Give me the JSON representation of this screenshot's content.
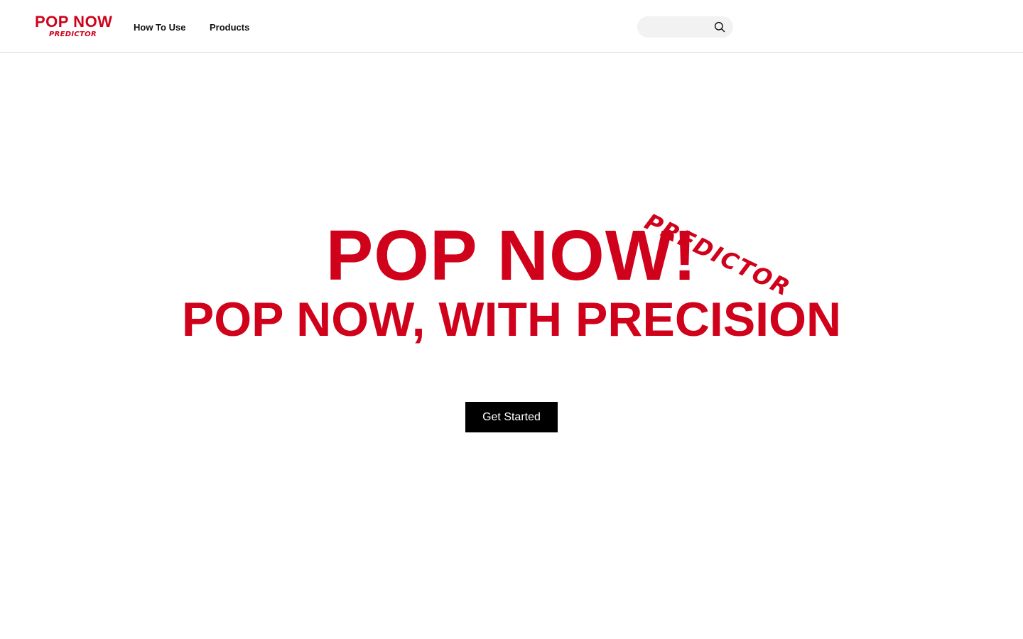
{
  "header": {
    "logo": {
      "main": "POP NOW",
      "sub": "PREDICTOR"
    },
    "nav": {
      "how_to_use": "How To Use",
      "products": "Products"
    },
    "search": {
      "value": "",
      "placeholder": "",
      "icon": "search-icon"
    }
  },
  "hero": {
    "title": "POP NOW!",
    "script_tag": "PREDICTOR",
    "subtitle": "POP NOW, WITH PRECISION",
    "cta_label": "Get Started"
  },
  "colors": {
    "brand_red": "#d0021b",
    "cta_background": "#000000",
    "cta_text": "#ffffff",
    "search_background": "#f2f2f2",
    "header_border": "#d6d6d6"
  }
}
